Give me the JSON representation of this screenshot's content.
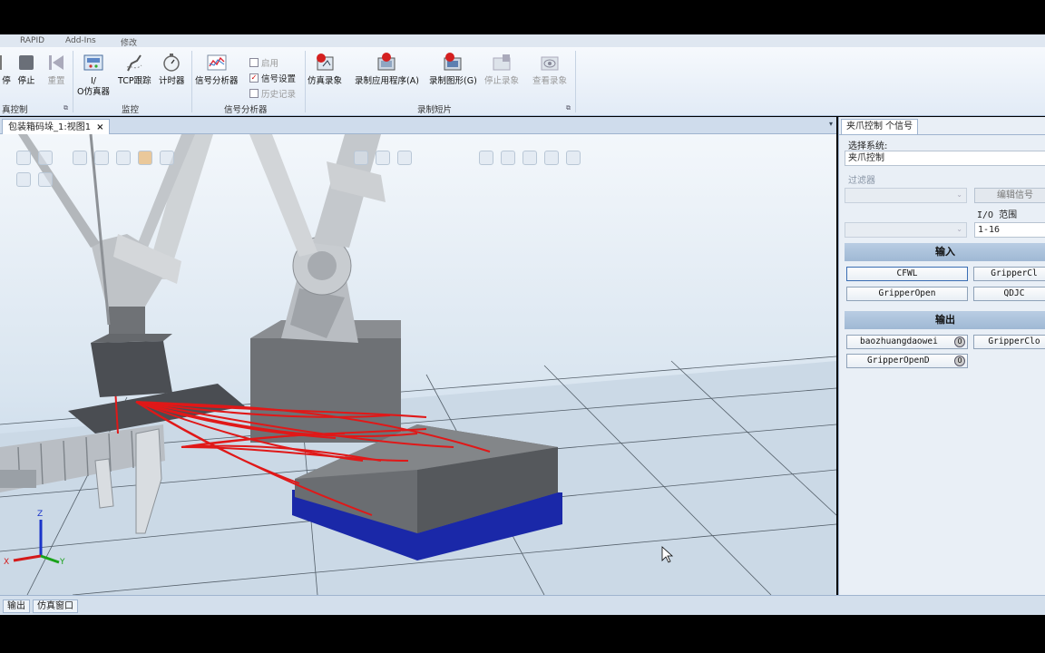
{
  "menu": {
    "tabs": [
      "RAPID",
      "Add-Ins",
      "修改"
    ]
  },
  "ribbon": {
    "sim_control": {
      "stop_partial": "停",
      "stop": "停止",
      "reset": "重置",
      "group_label": "真控制"
    },
    "monitor": {
      "io_sim_line1": "I/",
      "io_sim_line2": "O仿真器",
      "tcp_trace": "TCP跟踪",
      "timer": "计时器",
      "group_label": "监控"
    },
    "signal_analyzer": {
      "analyzer": "信号分析器",
      "enable": "启用",
      "signal_settings": "信号设置",
      "history": "历史记录",
      "group_label": "信号分析器"
    },
    "recording": {
      "sim_record": "仿真录象",
      "record_app": "录制应用程序(A)",
      "record_graphics": "录制图形(G)",
      "stop_record": "停止录象",
      "view_record": "查看录象",
      "group_label": "录制短片"
    }
  },
  "document": {
    "tab_title": "包装箱码垛_1:视图1",
    "close": "×",
    "dropdown": "▾"
  },
  "viewport": {
    "axis_labels": {
      "x": "X",
      "y": "Y",
      "z": "Z"
    },
    "colors": {
      "robot": "#c9cdd1",
      "pallet": "#1f2fae",
      "boxes": "#6b6e72",
      "paths": "#e01818",
      "floor": "#cbd9e6"
    }
  },
  "side_panel": {
    "tab_title": "夹爪控制 个信号",
    "select_system_label": "选择系统:",
    "system_value": "夹爪控制",
    "filter_label": "过滤器",
    "edit_signal_button": "编辑信号",
    "io_range_label": "I/O 范围",
    "io_range_value": "1-16",
    "inputs_header": "输入",
    "inputs": [
      "CFWL",
      "GripperCl",
      "GripperOpen",
      "QDJC"
    ],
    "outputs_header": "输出",
    "outputs": [
      "baozhuangdaowei",
      "GripperClo",
      "GripperOpenD"
    ],
    "output_indicator": "0"
  },
  "status_bar": {
    "tabs": [
      "输出",
      "仿真窗口"
    ]
  }
}
